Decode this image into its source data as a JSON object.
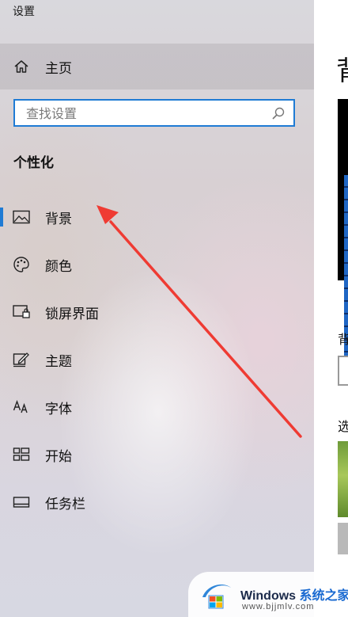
{
  "app": {
    "title": "设置"
  },
  "home": {
    "label": "主页",
    "icon": "home-icon"
  },
  "search": {
    "placeholder": "查找设置",
    "icon": "search-icon"
  },
  "section": {
    "title": "个性化"
  },
  "nav_items": [
    {
      "label": "背景",
      "icon": "picture-icon",
      "active": true
    },
    {
      "label": "颜色",
      "icon": "palette-icon",
      "active": false
    },
    {
      "label": "锁屏界面",
      "icon": "lock-screen-icon",
      "active": false
    },
    {
      "label": "主题",
      "icon": "theme-pen-icon",
      "active": false
    },
    {
      "label": "字体",
      "icon": "font-icon",
      "active": false
    },
    {
      "label": "开始",
      "icon": "start-tiles-icon",
      "active": false
    },
    {
      "label": "任务栏",
      "icon": "taskbar-icon",
      "active": false
    }
  ],
  "right_panel": {
    "title": "背",
    "background_label": "背",
    "choose_label": "选"
  },
  "colors": {
    "accent": "#1f7bd4",
    "arrow": "#ef3b33"
  },
  "watermark": {
    "brand_en": "Windows",
    "brand_cn": "系统之家",
    "url": "www.bjjmlv.com"
  }
}
